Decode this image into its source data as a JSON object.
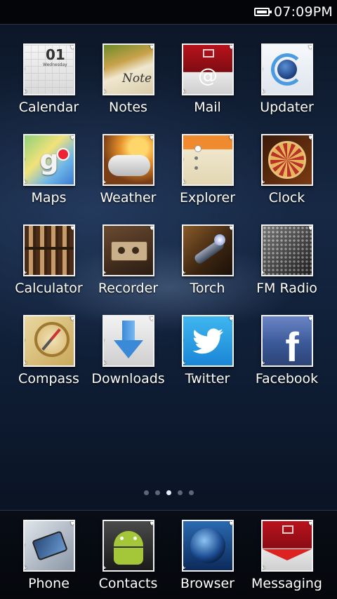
{
  "status_bar": {
    "time": "07:09PM",
    "battery_icon": "battery-full-icon"
  },
  "apps": [
    {
      "label": "Calendar",
      "icon": "calendar-icon",
      "date_num": "01",
      "date_day": "Wednesday"
    },
    {
      "label": "Notes",
      "icon": "notes-icon",
      "note_text": "Note"
    },
    {
      "label": "Mail",
      "icon": "mail-icon"
    },
    {
      "label": "Updater",
      "icon": "updater-icon"
    },
    {
      "label": "Maps",
      "icon": "maps-icon"
    },
    {
      "label": "Weather",
      "icon": "weather-icon"
    },
    {
      "label": "Explorer",
      "icon": "explorer-icon"
    },
    {
      "label": "Clock",
      "icon": "clock-icon"
    },
    {
      "label": "Calculator",
      "icon": "calculator-icon"
    },
    {
      "label": "Recorder",
      "icon": "recorder-icon"
    },
    {
      "label": "Torch",
      "icon": "torch-icon"
    },
    {
      "label": "FM Radio",
      "icon": "fm-radio-icon"
    },
    {
      "label": "Compass",
      "icon": "compass-icon"
    },
    {
      "label": "Downloads",
      "icon": "downloads-icon"
    },
    {
      "label": "Twitter",
      "icon": "twitter-icon"
    },
    {
      "label": "Facebook",
      "icon": "facebook-icon"
    }
  ],
  "page_indicator": {
    "total": 5,
    "active": 3
  },
  "dock": [
    {
      "label": "Phone",
      "icon": "phone-icon"
    },
    {
      "label": "Contacts",
      "icon": "contacts-icon"
    },
    {
      "label": "Browser",
      "icon": "browser-icon"
    },
    {
      "label": "Messaging",
      "icon": "messaging-icon"
    }
  ]
}
